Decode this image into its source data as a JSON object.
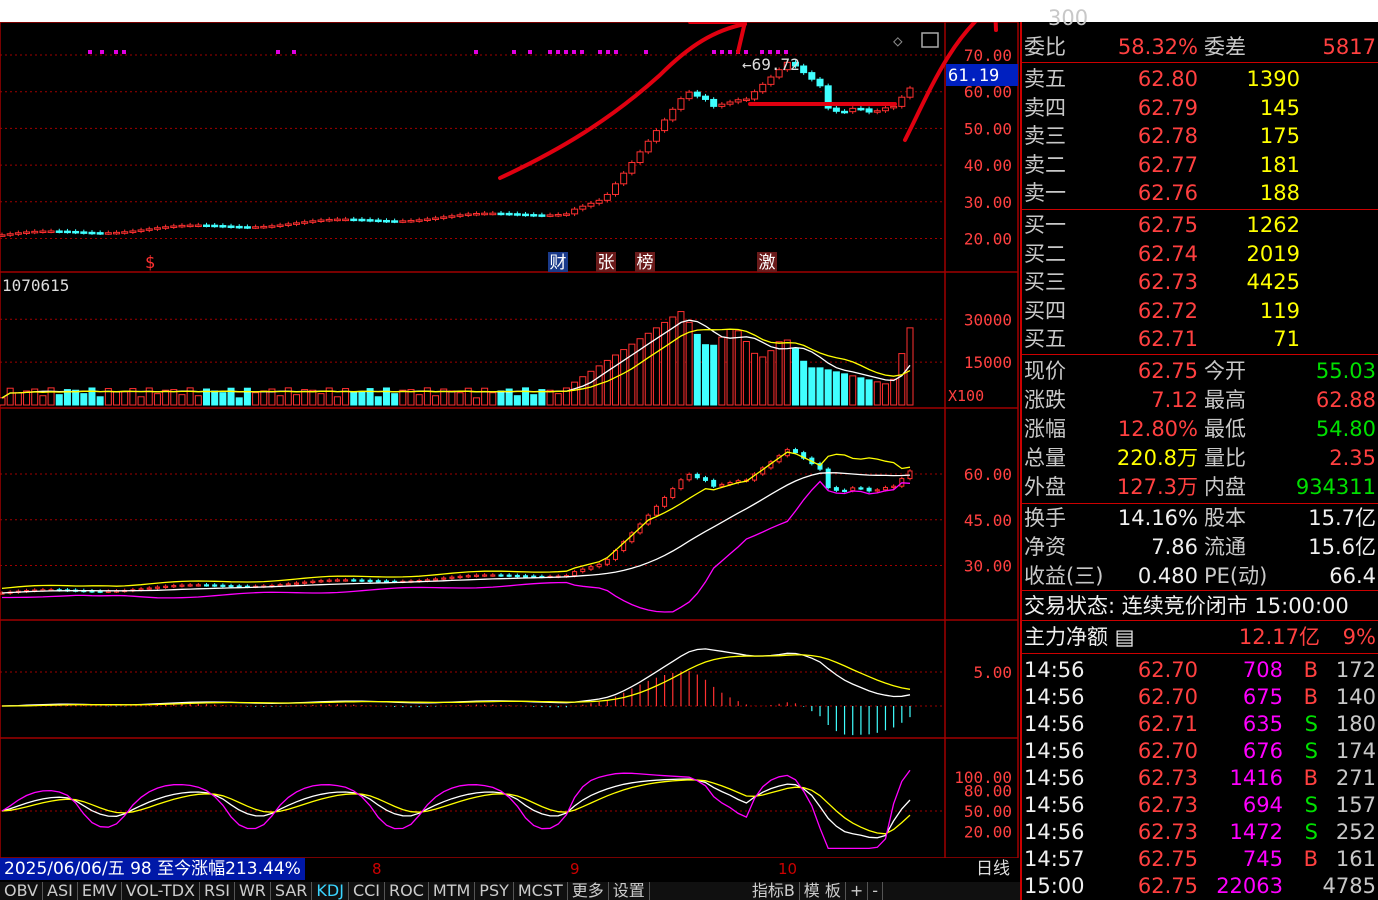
{
  "price_axis": [
    "70.00",
    "60.00",
    "50.00",
    "40.00",
    "30.00",
    "20.00"
  ],
  "current_price_tag": "61.19",
  "high_marker": "69.72",
  "volume_axis": [
    "30000",
    "15000",
    "X100"
  ],
  "volume_label": "1070615",
  "ma_axis": [
    "60.00",
    "45.00",
    "30.00"
  ],
  "macd_axis": [
    "5.00"
  ],
  "kdj_axis": [
    "100.00",
    "80.00",
    "50.00",
    "20.00"
  ],
  "event_tags": [
    {
      "text": "$",
      "color": "#ff3030",
      "bg": "none"
    },
    {
      "text": "财",
      "color": "#ffffff",
      "bg": "#1a3a8a"
    },
    {
      "text": "张",
      "color": "#ffffff",
      "bg": "#6a1a1a"
    },
    {
      "text": "榜",
      "color": "#ffffff",
      "bg": "#6a1a1a"
    },
    {
      "text": "激",
      "color": "#ffffff",
      "bg": "#6a1a1a"
    }
  ],
  "status_bar": {
    "info": "2025/06/06/五 98 至今涨幅213.44%",
    "month_ticks": [
      "8",
      "9",
      "10"
    ],
    "period": "日线"
  },
  "indicator_tabs": [
    "OBV",
    "ASI",
    "EMV",
    "VOL-TDX",
    "RSI",
    "WR",
    "SAR",
    "KDJ",
    "CCI",
    "ROC",
    "MTM",
    "PSY",
    "MCST",
    "更多",
    "设置"
  ],
  "active_tab": "KDJ",
  "right_tabs": [
    "指标B",
    "模 板",
    "+",
    "-"
  ],
  "quote": {
    "top_partial": "300",
    "weibi_label": "委比",
    "weibi": "58.32%",
    "weicha_label": "委差",
    "weicha": "5817",
    "asks": [
      {
        "label": "卖五",
        "price": "62.80",
        "vol": "1390"
      },
      {
        "label": "卖四",
        "price": "62.79",
        "vol": "145"
      },
      {
        "label": "卖三",
        "price": "62.78",
        "vol": "175"
      },
      {
        "label": "卖二",
        "price": "62.77",
        "vol": "181"
      },
      {
        "label": "卖一",
        "price": "62.76",
        "vol": "188"
      }
    ],
    "bids": [
      {
        "label": "买一",
        "price": "62.75",
        "vol": "1262"
      },
      {
        "label": "买二",
        "price": "62.74",
        "vol": "2019"
      },
      {
        "label": "买三",
        "price": "62.73",
        "vol": "4425"
      },
      {
        "label": "买四",
        "price": "62.72",
        "vol": "119"
      },
      {
        "label": "买五",
        "price": "62.71",
        "vol": "71"
      }
    ],
    "stats": [
      {
        "l1": "现价",
        "v1": "62.75",
        "c1": "red",
        "l2": "今开",
        "v2": "55.03",
        "c2": "grn"
      },
      {
        "l1": "涨跌",
        "v1": "7.12",
        "c1": "red",
        "l2": "最高",
        "v2": "62.88",
        "c2": "red"
      },
      {
        "l1": "涨幅",
        "v1": "12.80%",
        "c1": "red",
        "l2": "最低",
        "v2": "54.80",
        "c2": "grn"
      },
      {
        "l1": "总量",
        "v1": "220.8万",
        "c1": "yel",
        "l2": "量比",
        "v2": "2.35",
        "c2": "red"
      },
      {
        "l1": "外盘",
        "v1": "127.3万",
        "c1": "red",
        "l2": "内盘",
        "v2": "934311",
        "c2": "grn"
      },
      {
        "l1": "换手",
        "v1": "14.16%",
        "c1": "wht",
        "l2": "股本",
        "v2": "15.7亿",
        "c2": "wht"
      },
      {
        "l1": "净资",
        "v1": "7.86",
        "c1": "wht",
        "l2": "流通",
        "v2": "15.6亿",
        "c2": "wht"
      },
      {
        "l1": "收益(三)",
        "v1": "0.480",
        "c1": "wht",
        "l2": "PE(动)",
        "v2": "66.4",
        "c2": "wht"
      }
    ],
    "trade_status": "交易状态: 连续竞价闭市 15:00:00",
    "main_net_label": "主力净额",
    "main_net_value": "12.17亿",
    "main_net_pct": "9%",
    "ticks": [
      {
        "time": "14:56",
        "price": "62.70",
        "vol": "708",
        "side": "B",
        "num": "172"
      },
      {
        "time": "14:56",
        "price": "62.70",
        "vol": "675",
        "side": "B",
        "num": "140"
      },
      {
        "time": "14:56",
        "price": "62.71",
        "vol": "635",
        "side": "S",
        "num": "180"
      },
      {
        "time": "14:56",
        "price": "62.70",
        "vol": "676",
        "side": "S",
        "num": "174"
      },
      {
        "time": "14:56",
        "price": "62.73",
        "vol": "1416",
        "side": "B",
        "num": "271"
      },
      {
        "time": "14:56",
        "price": "62.73",
        "vol": "694",
        "side": "S",
        "num": "157"
      },
      {
        "time": "14:56",
        "price": "62.73",
        "vol": "1472",
        "side": "S",
        "num": "252"
      },
      {
        "time": "14:57",
        "price": "62.75",
        "vol": "745",
        "side": "B",
        "num": "161"
      },
      {
        "time": "15:00",
        "price": "62.75",
        "vol": "22063",
        "side": "",
        "num": "4785"
      }
    ]
  },
  "colors": {
    "up": "#ff3030",
    "down": "#40ffff",
    "grid": "#a00000",
    "ma1": "#ffffff",
    "ma2": "#ffff00",
    "ma3": "#ff00ff",
    "annot": "#e00010"
  }
}
